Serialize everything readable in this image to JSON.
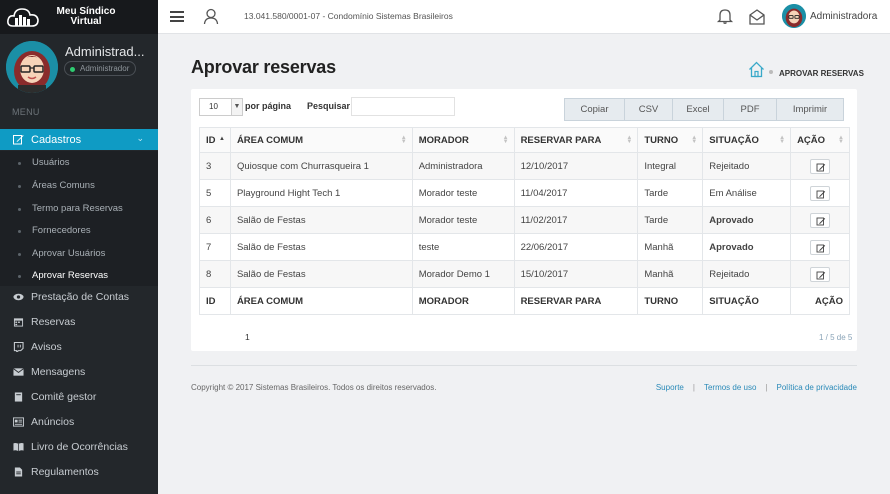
{
  "brand": {
    "line1": "Meu Síndico",
    "line2": "Virtual"
  },
  "profile": {
    "name": "Administrad...",
    "role": "Administrador"
  },
  "menu": {
    "label": "MENU",
    "active": "Cadastros",
    "submenu": [
      "Usuários",
      "Áreas Comuns",
      "Termo para Reservas",
      "Fornecedores",
      "Aprovar Usuários",
      "Aprovar Reservas"
    ],
    "active_sub": "Aprovar Reservas",
    "items": [
      {
        "label": "Prestação de Contas",
        "icon": "eye-icon"
      },
      {
        "label": "Reservas",
        "icon": "calendar-icon"
      },
      {
        "label": "Avisos",
        "icon": "twitch-icon"
      },
      {
        "label": "Mensagens",
        "icon": "envelope-icon"
      },
      {
        "label": "Comitê gestor",
        "icon": "book-icon"
      },
      {
        "label": "Anúncios",
        "icon": "newspaper-icon"
      },
      {
        "label": "Livro de Ocorrências",
        "icon": "open-book-icon"
      },
      {
        "label": "Regulamentos",
        "icon": "document-icon"
      }
    ]
  },
  "topbar": {
    "condo": "13.041.580/0001-07 - Condomínio Sistemas Brasileiros",
    "user": "Administradora"
  },
  "page": {
    "title": "Aprovar reservas",
    "breadcrumb": "APROVAR RESERVAS"
  },
  "controls": {
    "length_value": "10",
    "per_page": "por página",
    "search_label": "Pesquisar",
    "search_value": "",
    "buttons": [
      "Copiar",
      "CSV",
      "Excel",
      "PDF",
      "Imprimir"
    ]
  },
  "table": {
    "columns": [
      "ID",
      "ÁREA COMUM",
      "MORADOR",
      "RESERVAR PARA",
      "TURNO",
      "SITUAÇÃO",
      "AÇÃO"
    ],
    "rows": [
      {
        "id": "3",
        "area": "Quiosque com Churrasqueira 1",
        "morador": "Administradora",
        "data": "12/10/2017",
        "turno": "Integral",
        "situacao": "Rejeitado",
        "status": "red"
      },
      {
        "id": "5",
        "area": "Playground Hight Tech 1",
        "morador": "Morador teste",
        "data": "11/04/2017",
        "turno": "Tarde",
        "situacao": "Em Análise",
        "status": "blue"
      },
      {
        "id": "6",
        "area": "Salão de Festas",
        "morador": "Morador teste",
        "data": "11/02/2017",
        "turno": "Tarde",
        "situacao": "Aprovado",
        "status": "green"
      },
      {
        "id": "7",
        "area": "Salão de Festas",
        "morador": "teste",
        "data": "22/06/2017",
        "turno": "Manhã",
        "situacao": "Aprovado",
        "status": "green"
      },
      {
        "id": "8",
        "area": "Salão de Festas",
        "morador": "Morador Demo 1",
        "data": "15/10/2017",
        "turno": "Manhã",
        "situacao": "Rejeitado",
        "status": "red"
      }
    ]
  },
  "pagination": {
    "page": "1",
    "info": "1 / 5 de 5"
  },
  "footer": {
    "copyright": "Copyright © 2017 Sistemas Brasileiros. Todos os direitos reservados.",
    "links": [
      "Suporte",
      "Termos de uso",
      "Política de privacidade"
    ]
  },
  "colors": {
    "accent": "#0f9bc4",
    "sidebar": "#23272b",
    "rejected": "#e0081b",
    "analysis": "#0a2fcc",
    "approved": "#138a1d"
  }
}
